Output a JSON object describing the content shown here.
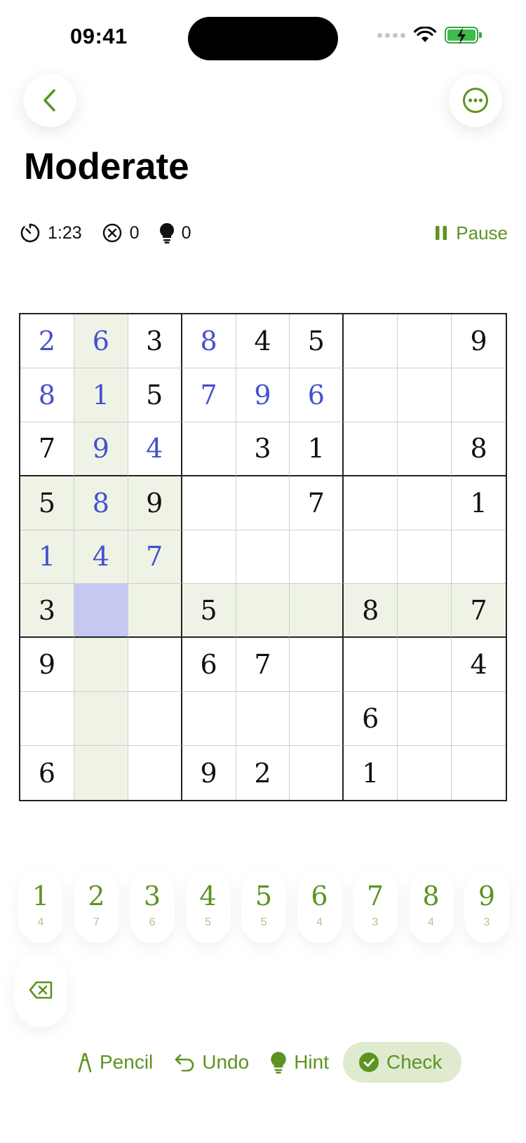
{
  "status": {
    "time": "09:41"
  },
  "header": {
    "title": "Moderate"
  },
  "stats": {
    "timer": "1:23",
    "mistakes": "0",
    "hints": "0",
    "pause_label": "Pause"
  },
  "board": {
    "cells": [
      [
        "2",
        "6",
        "3",
        "8",
        "4",
        "5",
        "",
        "",
        "9"
      ],
      [
        "8",
        "1",
        "5",
        "7",
        "9",
        "6",
        "",
        "",
        ""
      ],
      [
        "7",
        "9",
        "4",
        "",
        "3",
        "1",
        "",
        "",
        "8"
      ],
      [
        "5",
        "8",
        "9",
        "",
        "",
        "7",
        "",
        "",
        "1"
      ],
      [
        "1",
        "4",
        "7",
        "",
        "",
        "",
        "",
        "",
        ""
      ],
      [
        "3",
        "",
        "",
        "5",
        "",
        "",
        "8",
        "",
        "7"
      ],
      [
        "9",
        "",
        "",
        "6",
        "7",
        "",
        "",
        "",
        "4"
      ],
      [
        "",
        "",
        "",
        "",
        "",
        "",
        "6",
        "",
        ""
      ],
      [
        "6",
        "",
        "",
        "9",
        "2",
        "",
        "1",
        "",
        ""
      ]
    ],
    "user_entered": [
      [
        true,
        true,
        false,
        true,
        false,
        false,
        false,
        false,
        false
      ],
      [
        true,
        true,
        false,
        true,
        true,
        true,
        false,
        false,
        false
      ],
      [
        false,
        true,
        true,
        false,
        false,
        false,
        false,
        false,
        false
      ],
      [
        false,
        true,
        false,
        false,
        false,
        false,
        false,
        false,
        false
      ],
      [
        true,
        true,
        true,
        false,
        false,
        false,
        false,
        false,
        false
      ],
      [
        false,
        false,
        false,
        false,
        false,
        false,
        false,
        false,
        false
      ],
      [
        false,
        false,
        false,
        false,
        false,
        false,
        false,
        false,
        false
      ],
      [
        false,
        false,
        false,
        false,
        false,
        false,
        false,
        false,
        false
      ],
      [
        false,
        false,
        false,
        false,
        false,
        false,
        false,
        false,
        false
      ]
    ],
    "selected": {
      "row": 5,
      "col": 1
    }
  },
  "numpad": [
    {
      "digit": "1",
      "remaining": "4"
    },
    {
      "digit": "2",
      "remaining": "7"
    },
    {
      "digit": "3",
      "remaining": "6"
    },
    {
      "digit": "4",
      "remaining": "5"
    },
    {
      "digit": "5",
      "remaining": "5"
    },
    {
      "digit": "6",
      "remaining": "4"
    },
    {
      "digit": "7",
      "remaining": "3"
    },
    {
      "digit": "8",
      "remaining": "4"
    },
    {
      "digit": "9",
      "remaining": "3"
    }
  ],
  "tools": {
    "pencil": "Pencil",
    "undo": "Undo",
    "hint": "Hint",
    "check": "Check"
  },
  "colors": {
    "accent": "#5c9420",
    "user_digit": "#4450d0",
    "highlight": "#eef3e6",
    "selected": "#c6c8f2"
  },
  "icons": [
    "back-chevron-icon",
    "more-options-icon",
    "timer-icon",
    "mistakes-icon",
    "hint-bulb-icon",
    "pause-icon",
    "erase-icon",
    "pencil-icon",
    "undo-icon",
    "check-circle-icon",
    "wifi-icon",
    "battery-icon"
  ]
}
